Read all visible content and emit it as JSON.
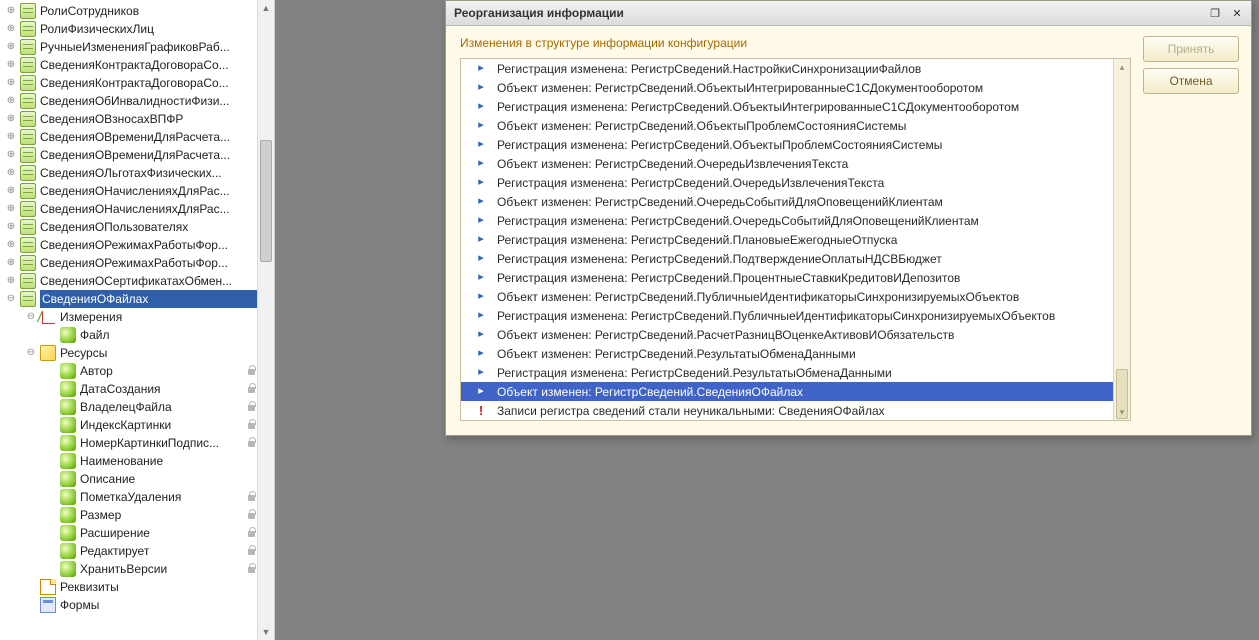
{
  "tree": {
    "items": [
      {
        "exp": "plus",
        "icon": "reg",
        "label": "РолиСотрудников",
        "lock": true,
        "cube": false,
        "indent": 0
      },
      {
        "exp": "plus",
        "icon": "reg",
        "label": "РолиФизическихЛиц",
        "lock": true,
        "cube": false,
        "indent": 0
      },
      {
        "exp": "plus",
        "icon": "reg",
        "label": "РучныеИзмененияГрафиковРаб...",
        "lock": true,
        "cube": false,
        "indent": 0
      },
      {
        "exp": "plus",
        "icon": "reg",
        "label": "СведенияКонтрактаДоговораСо...",
        "lock": true,
        "cube": false,
        "indent": 0
      },
      {
        "exp": "plus",
        "icon": "reg",
        "label": "СведенияКонтрактаДоговораСо...",
        "lock": true,
        "cube": false,
        "indent": 0
      },
      {
        "exp": "plus",
        "icon": "reg",
        "label": "СведенияОбИнвалидностиФизи...",
        "lock": true,
        "cube": false,
        "indent": 0
      },
      {
        "exp": "plus",
        "icon": "reg",
        "label": "СведенияОВзносахВПФР",
        "lock": true,
        "cube": false,
        "indent": 0
      },
      {
        "exp": "plus",
        "icon": "reg",
        "label": "СведенияОВремениДляРасчета...",
        "lock": true,
        "cube": false,
        "indent": 0
      },
      {
        "exp": "plus",
        "icon": "reg",
        "label": "СведенияОВремениДляРасчета...",
        "lock": true,
        "cube": false,
        "indent": 0
      },
      {
        "exp": "plus",
        "icon": "reg",
        "label": "СведенияОЛьготахФизических...",
        "lock": true,
        "cube": false,
        "indent": 0
      },
      {
        "exp": "plus",
        "icon": "reg",
        "label": "СведенияОНачисленияхДляРас...",
        "lock": true,
        "cube": false,
        "indent": 0
      },
      {
        "exp": "plus",
        "icon": "reg",
        "label": "СведенияОНачисленияхДляРас...",
        "lock": true,
        "cube": false,
        "indent": 0
      },
      {
        "exp": "plus",
        "icon": "reg",
        "label": "СведенияОПользователях",
        "lock": true,
        "cube": false,
        "indent": 0
      },
      {
        "exp": "plus",
        "icon": "reg",
        "label": "СведенияОРежимахРаботыФор...",
        "lock": true,
        "cube": false,
        "indent": 0
      },
      {
        "exp": "plus",
        "icon": "reg",
        "label": "СведенияОРежимахРаботыФор...",
        "lock": true,
        "cube": false,
        "indent": 0
      },
      {
        "exp": "plus",
        "icon": "reg",
        "label": "СведенияОСертификатахОбмен...",
        "lock": true,
        "cube": false,
        "indent": 0
      },
      {
        "exp": "minus",
        "icon": "reg",
        "label": "СведенияОФайлах",
        "lock": true,
        "cube": false,
        "indent": 0,
        "selected": true
      },
      {
        "exp": "minus",
        "icon": "dim",
        "label": "Измерения",
        "lock": false,
        "cube": false,
        "indent": 1
      },
      {
        "exp": "none",
        "icon": "bullet",
        "label": "Файл",
        "lock": false,
        "cube": false,
        "indent": 2
      },
      {
        "exp": "minus",
        "icon": "res",
        "label": "Ресурсы",
        "lock": false,
        "cube": false,
        "indent": 1
      },
      {
        "exp": "none",
        "icon": "bullet",
        "label": "Автор",
        "lock": true,
        "cube": true,
        "indent": 2
      },
      {
        "exp": "none",
        "icon": "bullet",
        "label": "ДатаСоздания",
        "lock": true,
        "cube": true,
        "indent": 2
      },
      {
        "exp": "none",
        "icon": "bullet",
        "label": "ВладелецФайла",
        "lock": true,
        "cube": true,
        "indent": 2
      },
      {
        "exp": "none",
        "icon": "bullet",
        "label": "ИндексКартинки",
        "lock": true,
        "cube": true,
        "indent": 2
      },
      {
        "exp": "none",
        "icon": "bullet",
        "label": "НомерКартинкиПодпис...",
        "lock": true,
        "cube": true,
        "indent": 2
      },
      {
        "exp": "none",
        "icon": "bullet",
        "label": "Наименование",
        "lock": false,
        "cube": false,
        "indent": 2
      },
      {
        "exp": "none",
        "icon": "bullet",
        "label": "Описание",
        "lock": false,
        "cube": false,
        "indent": 2
      },
      {
        "exp": "none",
        "icon": "bullet",
        "label": "ПометкаУдаления",
        "lock": true,
        "cube": true,
        "indent": 2
      },
      {
        "exp": "none",
        "icon": "bullet",
        "label": "Размер",
        "lock": true,
        "cube": true,
        "indent": 2
      },
      {
        "exp": "none",
        "icon": "bullet",
        "label": "Расширение",
        "lock": true,
        "cube": true,
        "indent": 2
      },
      {
        "exp": "none",
        "icon": "bullet",
        "label": "Редактирует",
        "lock": true,
        "cube": true,
        "indent": 2
      },
      {
        "exp": "none",
        "icon": "bullet",
        "label": "ХранитьВерсии",
        "lock": true,
        "cube": true,
        "indent": 2
      },
      {
        "exp": "none",
        "icon": "file",
        "label": "Реквизиты",
        "lock": false,
        "cube": false,
        "indent": 1
      },
      {
        "exp": "none",
        "icon": "form",
        "label": "Формы",
        "lock": false,
        "cube": false,
        "indent": 1
      }
    ]
  },
  "dialog": {
    "title": "Реорганизация информации",
    "message": "Изменения в структуре информации конфигурации",
    "accept_label": "Принять",
    "cancel_label": "Отмена",
    "rows": [
      {
        "mark": "arrow",
        "text": "Регистрация изменена: РегистрСведений.НастройкиСинхронизацииФайлов"
      },
      {
        "mark": "arrow",
        "text": "Объект изменен: РегистрСведений.ОбъектыИнтегрированныеС1СДокументооборотом"
      },
      {
        "mark": "arrow",
        "text": "Регистрация изменена: РегистрСведений.ОбъектыИнтегрированныеС1СДокументооборотом"
      },
      {
        "mark": "arrow",
        "text": "Объект изменен: РегистрСведений.ОбъектыПроблемСостоянияСистемы"
      },
      {
        "mark": "arrow",
        "text": "Регистрация изменена: РегистрСведений.ОбъектыПроблемСостоянияСистемы"
      },
      {
        "mark": "arrow",
        "text": "Объект изменен: РегистрСведений.ОчередьИзвлеченияТекста"
      },
      {
        "mark": "arrow",
        "text": "Регистрация изменена: РегистрСведений.ОчередьИзвлеченияТекста"
      },
      {
        "mark": "arrow",
        "text": "Объект изменен: РегистрСведений.ОчередьСобытийДляОповещенийКлиентам"
      },
      {
        "mark": "arrow",
        "text": "Регистрация изменена: РегистрСведений.ОчередьСобытийДляОповещенийКлиентам"
      },
      {
        "mark": "arrow",
        "text": "Регистрация изменена: РегистрСведений.ПлановыеЕжегодныеОтпуска"
      },
      {
        "mark": "arrow",
        "text": "Регистрация изменена: РегистрСведений.ПодтверждениеОплатыНДСВБюджет"
      },
      {
        "mark": "arrow",
        "text": "Регистрация изменена: РегистрСведений.ПроцентныеСтавкиКредитовИДепозитов"
      },
      {
        "mark": "arrow",
        "text": "Объект изменен: РегистрСведений.ПубличныеИдентификаторыСинхронизируемыхОбъектов"
      },
      {
        "mark": "arrow",
        "text": "Регистрация изменена: РегистрСведений.ПубличныеИдентификаторыСинхронизируемыхОбъектов"
      },
      {
        "mark": "arrow",
        "text": "Объект изменен: РегистрСведений.РасчетРазницВОценкеАктивовИОбязательств"
      },
      {
        "mark": "arrow",
        "text": "Объект изменен: РегистрСведений.РезультатыОбменаДанными"
      },
      {
        "mark": "arrow",
        "text": "Регистрация изменена: РегистрСведений.РезультатыОбменаДанными"
      },
      {
        "mark": "arrow",
        "text": "Объект изменен: РегистрСведений.СведенияОФайлах",
        "hl": true
      },
      {
        "mark": "warn",
        "text": "Записи регистра сведений стали неуникальными: СведенияОФайлах"
      }
    ]
  }
}
